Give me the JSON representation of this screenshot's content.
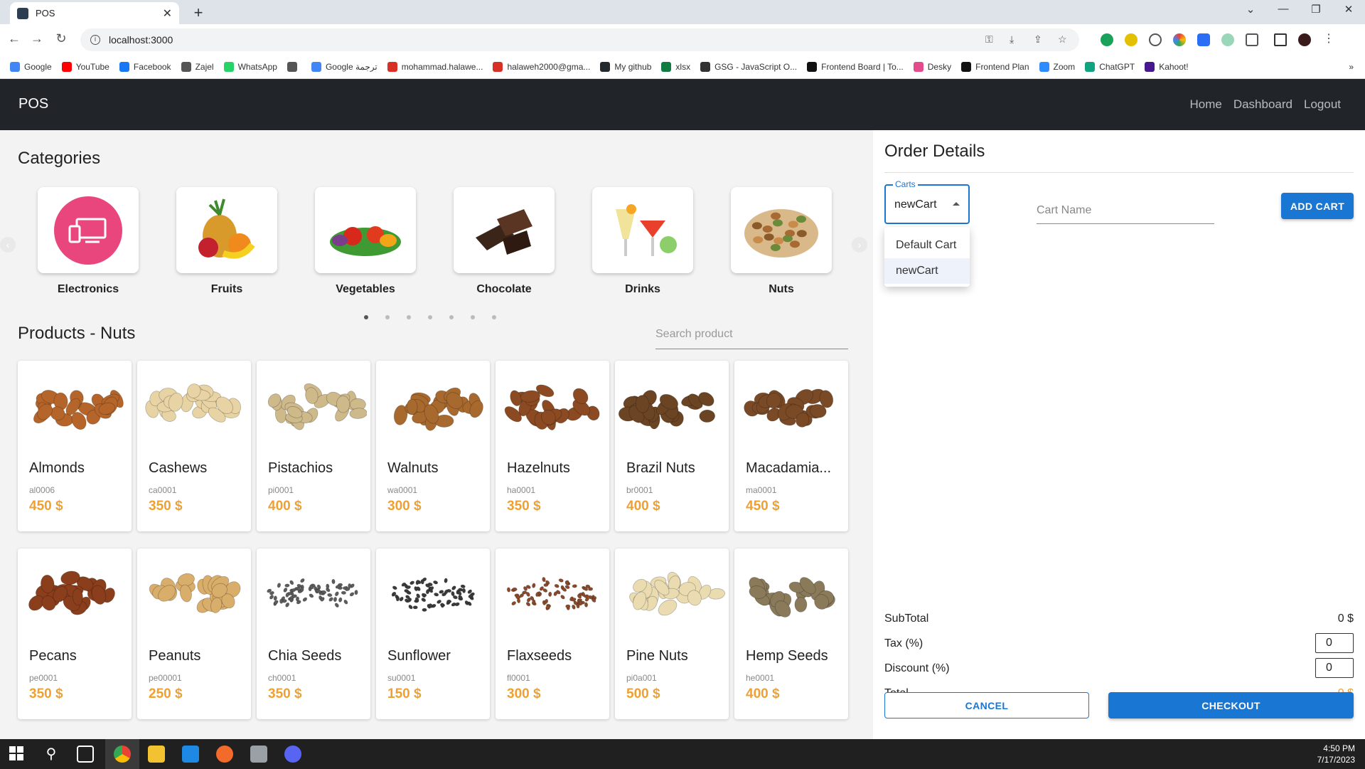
{
  "browser": {
    "tab_title": "POS",
    "url": "localhost:3000",
    "bookmarks": [
      "Google",
      "YouTube",
      "Facebook",
      "Zajel",
      "WhatsApp",
      "",
      "Google ترجمة",
      "mohammad.halawe...",
      "halaweh2000@gma...",
      "My github",
      "xlsx",
      "GSG - JavaScript O...",
      "Frontend Board | To...",
      "Desky",
      "Frontend Plan",
      "Zoom",
      "ChatGPT",
      "Kahoot!"
    ],
    "bookmark_colors": [
      "#4285f4",
      "#ff0000",
      "#1877f2",
      "#555555",
      "#25d366",
      "#555555",
      "#4285f4",
      "#d93025",
      "#d93025",
      "#24292e",
      "#107c41",
      "#333333",
      "#111111",
      "#e44b8d",
      "#111111",
      "#2d8cff",
      "#10a37f",
      "#46178f"
    ]
  },
  "app": {
    "brand": "POS",
    "nav": {
      "home": "Home",
      "dashboard": "Dashboard",
      "logout": "Logout"
    }
  },
  "categories": {
    "heading": "Categories",
    "items": [
      {
        "name": "Electronics",
        "icon": "electronics-icon",
        "color": "#e8467c"
      },
      {
        "name": "Fruits",
        "icon": "fruits-icon",
        "color": "#f5a623"
      },
      {
        "name": "Vegetables",
        "icon": "vegetables-icon",
        "color": "#d93a2b"
      },
      {
        "name": "Chocolate",
        "icon": "chocolate-icon",
        "color": "#3b2418"
      },
      {
        "name": "Drinks",
        "icon": "drinks-icon",
        "color": "#e8c25a"
      },
      {
        "name": "Nuts",
        "icon": "nuts-icon",
        "color": "#b07a3c"
      }
    ],
    "page_dots": 7,
    "active_dot": 0
  },
  "products": {
    "heading": "Products - Nuts",
    "search_placeholder": "Search product",
    "items": [
      {
        "name": "Almonds",
        "sku": "al0006",
        "price": "450 $",
        "color": "#b5652a"
      },
      {
        "name": "Cashews",
        "sku": "ca0001",
        "price": "350 $",
        "color": "#e8d3a4"
      },
      {
        "name": "Pistachios",
        "sku": "pi0001",
        "price": "400 $",
        "color": "#cdb98a"
      },
      {
        "name": "Walnuts",
        "sku": "wa0001",
        "price": "300 $",
        "color": "#a8692e"
      },
      {
        "name": "Hazelnuts",
        "sku": "ha0001",
        "price": "350 $",
        "color": "#8b4a22"
      },
      {
        "name": "Brazil Nuts",
        "sku": "br0001",
        "price": "400 $",
        "color": "#6b4423"
      },
      {
        "name": "Macadamia...",
        "sku": "ma0001",
        "price": "450 $",
        "color": "#7a4a26"
      },
      {
        "name": "Pecans",
        "sku": "pe0001",
        "price": "350 $",
        "color": "#8a3e1c"
      },
      {
        "name": "Peanuts",
        "sku": "pe00001",
        "price": "250 $",
        "color": "#d9ad6a"
      },
      {
        "name": "Chia Seeds",
        "sku": "ch0001",
        "price": "350 $",
        "color": "#5c5c5c"
      },
      {
        "name": "Sunflower",
        "sku": "su0001",
        "price": "150 $",
        "color": "#3a3a3a"
      },
      {
        "name": "Flaxseeds",
        "sku": "fl0001",
        "price": "300 $",
        "color": "#8a4a2a"
      },
      {
        "name": "Pine Nuts",
        "sku": "pi0a001",
        "price": "500 $",
        "color": "#eadcb0"
      },
      {
        "name": "Hemp Seeds",
        "sku": "he0001",
        "price": "400 $",
        "color": "#8a7a5a"
      }
    ]
  },
  "order": {
    "heading": "Order Details",
    "carts_label": "Carts",
    "selected_cart": "newCart",
    "cart_options": [
      "Default Cart",
      "newCart"
    ],
    "cart_name_placeholder": "Cart Name",
    "add_cart": "ADD CART",
    "subtotal_label": "SubTotal",
    "subtotal_value": "0 $",
    "tax_label": "Tax (%)",
    "tax_value": "0",
    "discount_label": "Discount (%)",
    "discount_value": "0",
    "total_label": "Total",
    "total_value": "0 $",
    "cancel": "CANCEL",
    "checkout": "CHECKOUT"
  },
  "taskbar": {
    "time": "4:50 PM",
    "date": "7/17/2023"
  },
  "colors": {
    "primary": "#1976d2",
    "price_accent": "#f0a030",
    "appbar": "#212529"
  }
}
